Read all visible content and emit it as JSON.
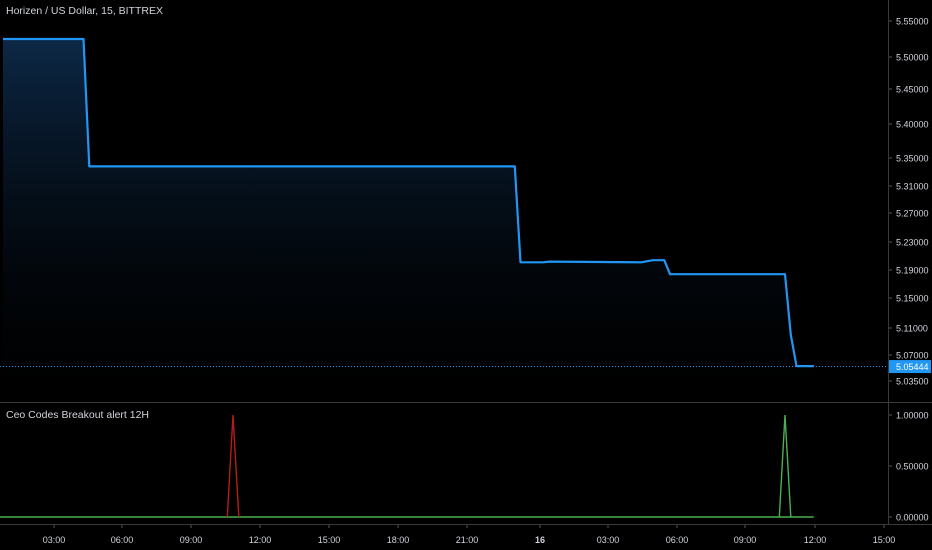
{
  "header": {
    "symbol_title": "Horizen / US Dollar, 15, BITTREX"
  },
  "indicator": {
    "title": "Ceo Codes Breakout alert 12H"
  },
  "colors": {
    "background": "#000000",
    "price_line": "#2196f3",
    "price_fill_top": "#0d2a4a",
    "axis_text": "#d1d4dc",
    "divider": "#3a3a3a",
    "last_price_badge": "#2196f3",
    "bear_signal": "#b71c1c",
    "bull_signal": "#4caf50"
  },
  "chart_data": [
    {
      "type": "area",
      "title": "Horizen / US Dollar, 15, BITTREX",
      "x_ticks": [
        "03:00",
        "06:00",
        "09:00",
        "12:00",
        "15:00",
        "18:00",
        "21:00",
        "16",
        "03:00",
        "06:00",
        "09:00",
        "12:00",
        "15:00"
      ],
      "y_ticks": [
        "5.55000",
        "5.50000",
        "5.45000",
        "5.40000",
        "5.35000",
        "5.31000",
        "5.27000",
        "5.23000",
        "5.19000",
        "5.15000",
        "5.11000",
        "5.07000",
        "5.03500"
      ],
      "ylim": [
        5.03,
        5.565
      ],
      "last_price": "5.05444",
      "series": [
        {
          "x": [
            "00:00",
            "03:30",
            "03:45",
            "22:15",
            "22:30",
            "23:30",
            "23:45",
            "03:45",
            "04:15",
            "04:45",
            "05:00",
            "10:00",
            "10:15",
            "10:30",
            "11:15"
          ],
          "values": [
            5.525,
            5.525,
            5.338,
            5.338,
            5.201,
            5.201,
            5.202,
            5.201,
            5.204,
            5.204,
            5.184,
            5.184,
            5.1,
            5.055,
            5.055
          ]
        }
      ]
    },
    {
      "type": "line",
      "title": "Ceo Codes Breakout alert 12H",
      "y_ticks": [
        "1.00000",
        "0.50000",
        "0.00000"
      ],
      "ylim": [
        0,
        1
      ],
      "series": [
        {
          "color": "#b71c1c",
          "x": [
            "09:45",
            "10:00",
            "10:15"
          ],
          "values": [
            0,
            1,
            0
          ]
        },
        {
          "color": "#4caf50",
          "x": [
            "09:45",
            "10:00",
            "10:15"
          ],
          "values": [
            0,
            1,
            0
          ]
        }
      ]
    }
  ]
}
